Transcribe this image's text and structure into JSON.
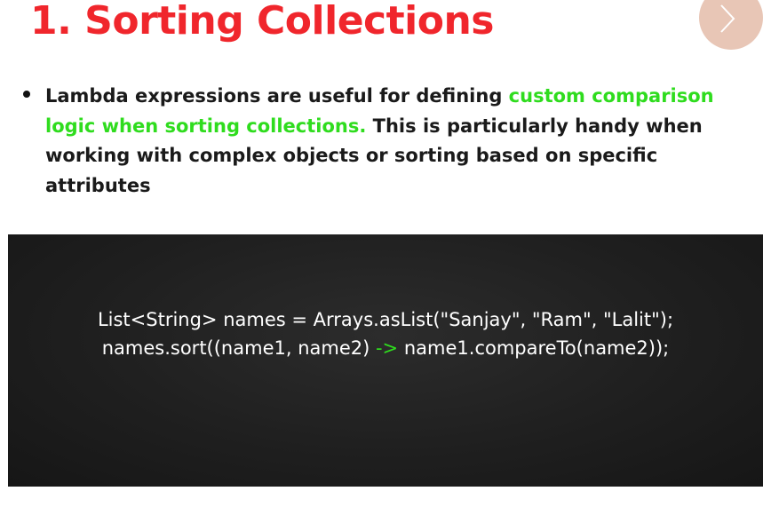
{
  "slide": {
    "title": "1. Sorting Collections",
    "next_icon": "chevron-right-icon",
    "accent_color": "#f0262c",
    "highlight_color": "#2fdc1e"
  },
  "bullet": {
    "text_before": "Lambda expressions are useful for defining ",
    "text_highlight": "custom comparison logic when sorting collections.",
    "text_after": " This is particularly handy when working with complex objects or sorting based on specific attributes"
  },
  "code": {
    "line1": "List<String> names = Arrays.asList(\"Sanjay\", \"Ram\", \"Lalit\");",
    "line2_before": "names.sort((name1, name2) ",
    "line2_arrow": "->",
    "line2_after": " name1.compareTo(name2));"
  }
}
